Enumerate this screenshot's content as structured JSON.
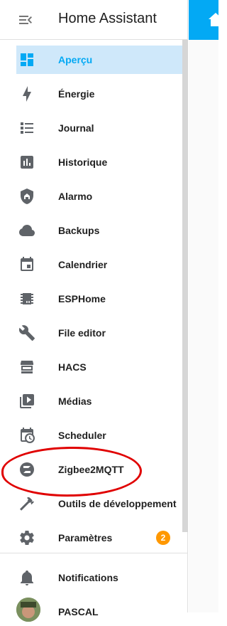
{
  "app": {
    "title": "Home Assistant"
  },
  "sidebar": {
    "items": [
      {
        "label": "Aperçu",
        "icon": "dashboard-icon"
      },
      {
        "label": "Énergie",
        "icon": "lightning-bolt-icon"
      },
      {
        "label": "Journal",
        "icon": "format-list-icon"
      },
      {
        "label": "Historique",
        "icon": "chart-box-icon"
      },
      {
        "label": "Alarmo",
        "icon": "shield-home-icon"
      },
      {
        "label": "Backups",
        "icon": "cloud-icon"
      },
      {
        "label": "Calendrier",
        "icon": "calendar-icon"
      },
      {
        "label": "ESPHome",
        "icon": "chip-icon"
      },
      {
        "label": "File editor",
        "icon": "wrench-icon"
      },
      {
        "label": "HACS",
        "icon": "hacs-icon"
      },
      {
        "label": "Médias",
        "icon": "play-box-icon"
      },
      {
        "label": "Scheduler",
        "icon": "calendar-clock-icon"
      },
      {
        "label": "Zigbee2MQTT",
        "icon": "zigbee-icon"
      },
      {
        "label": "Outils de développement",
        "icon": "hammer-icon"
      },
      {
        "label": "Paramètres",
        "icon": "gear-icon",
        "badge": "2"
      }
    ],
    "notifications": {
      "label": "Notifications",
      "icon": "bell-icon"
    },
    "user": {
      "name": "PASCAL"
    }
  },
  "colors": {
    "accent": "#03a9f4",
    "active_bg": "#cfe8fa",
    "badge": "#ff9800",
    "annotation": "#e00000"
  }
}
